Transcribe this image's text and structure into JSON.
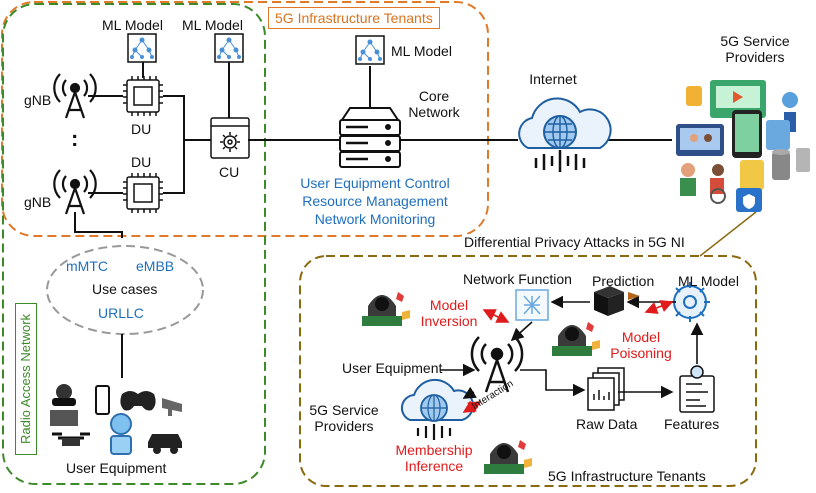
{
  "tenants_top": "5G Infrastructure Tenants",
  "ran_label": "Radio Access Network",
  "ran": {
    "gnb1": "gNB",
    "gnb_ellipsis": ":",
    "gnb2": "gNB",
    "du1": "DU",
    "du2": "DU",
    "cu": "CU",
    "ml_model_1": "ML Model",
    "ml_model_2": "ML Model"
  },
  "core": {
    "ml_model": "ML Model",
    "core_network": "Core\nNetwork",
    "functions": [
      "User Equipment Control",
      "Resource Management",
      "Network Monitoring"
    ]
  },
  "internet": "Internet",
  "service_providers_top": "5G Service\nProviders",
  "use_cases": {
    "mmtc": "mMTC",
    "embb": "eMBB",
    "title": "Use cases",
    "urllc": "URLLC"
  },
  "ue_bottom": "User Equipment",
  "attack": {
    "title": "Differential Privacy Attacks in 5G NI",
    "network_function": "Network Function",
    "prediction": "Prediction",
    "ml_model": "ML Model",
    "model_inversion": "Model\nInversion",
    "model_poisoning": "Model\nPoisoning",
    "user_equipment": "User Equipment",
    "service_providers": "5G Service\nProviders",
    "interaction": "Interaction",
    "membership_inference": "Membership\nInference",
    "raw_data": "Raw Data",
    "features": "Features",
    "tenants_bottom": "5G Infrastructure Tenants"
  },
  "colors": {
    "orange_border": "#e07a2a",
    "green_border": "#3d8a2a",
    "olive_border": "#8a6a10",
    "attack_text": "#e01b1b",
    "function_text": "#1f6fbf"
  }
}
